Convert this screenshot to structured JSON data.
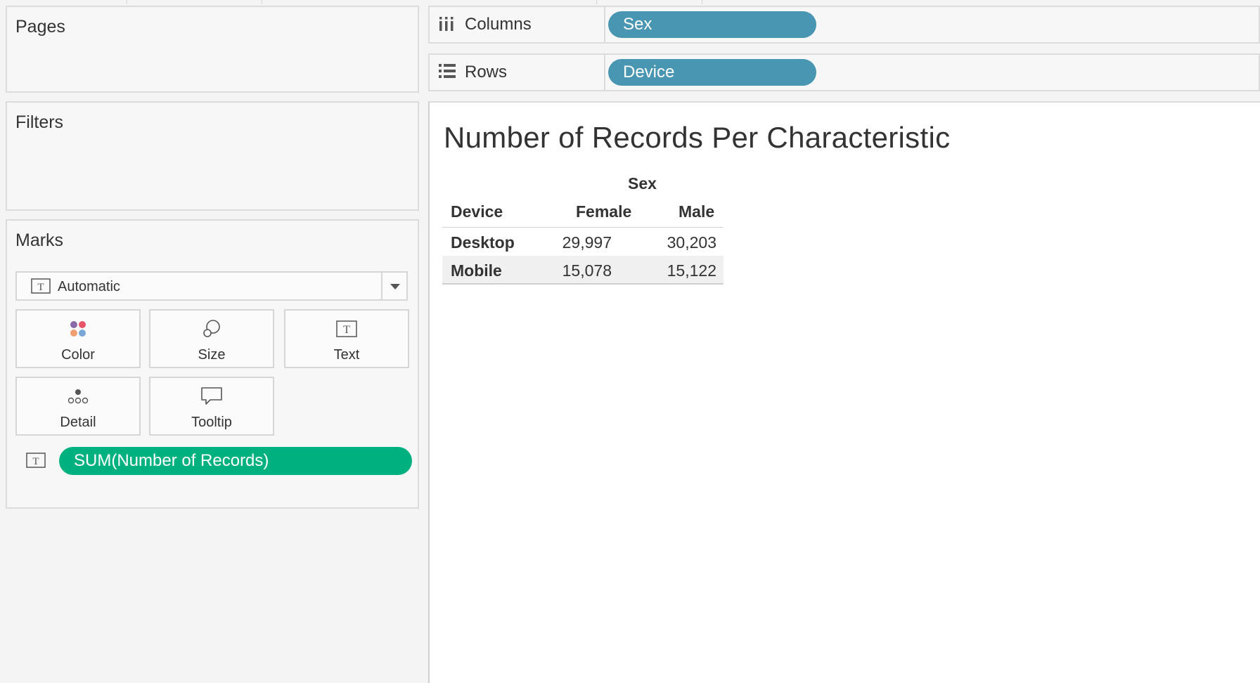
{
  "pages_card": {
    "title": "Pages"
  },
  "filters_card": {
    "title": "Filters"
  },
  "marks_card": {
    "title": "Marks",
    "mark_type": "Automatic",
    "buttons": {
      "color": "Color",
      "size": "Size",
      "text": "Text",
      "detail": "Detail",
      "tooltip": "Tooltip"
    },
    "fields": [
      {
        "label": "SUM(Number of Records)",
        "encoding_icon": "text-icon",
        "color": "#00b180"
      }
    ]
  },
  "shelves": {
    "columns": {
      "label": "Columns",
      "pill": "Sex",
      "pill_color": "#4996b2"
    },
    "rows": {
      "label": "Rows",
      "pill": "Device",
      "pill_color": "#4996b2"
    }
  },
  "view": {
    "title": "Number of Records Per Characteristic",
    "crosstab": {
      "column_field": "Sex",
      "row_header": "Device",
      "columns": [
        "Female",
        "Male"
      ],
      "rows": [
        {
          "label": "Desktop",
          "values": [
            "29,997",
            "30,203"
          ]
        },
        {
          "label": "Mobile",
          "values": [
            "15,078",
            "15,122"
          ]
        }
      ]
    }
  }
}
